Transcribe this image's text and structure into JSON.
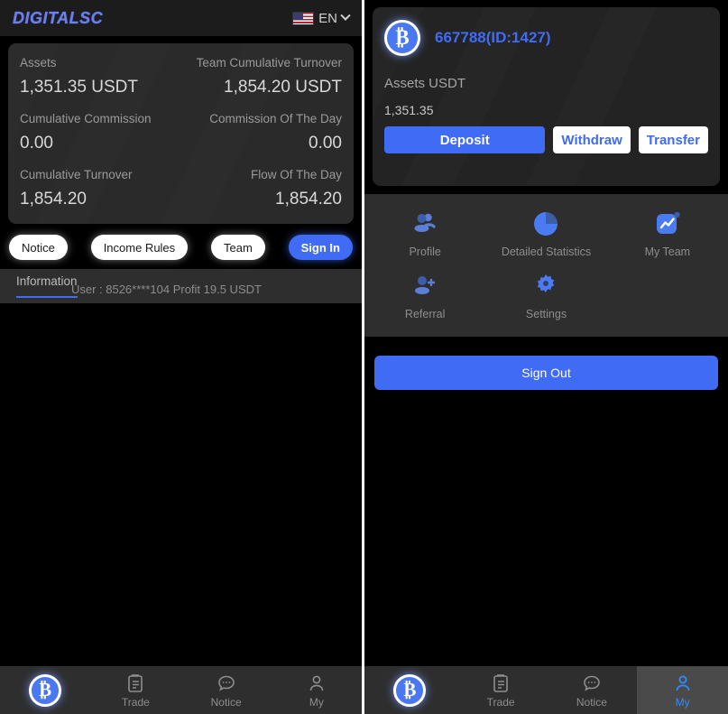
{
  "left": {
    "header": {
      "brand": "DIGITALSC",
      "lang": "EN",
      "flag_icon": "us-flag-icon",
      "chevron_icon": "chevron-down-icon"
    },
    "stats": [
      {
        "label": "Assets",
        "value": "1,351.35 USDT"
      },
      {
        "label": "Team Cumulative Turnover",
        "value": "1,854.20 USDT"
      },
      {
        "label": "Cumulative Commission",
        "value": "0.00"
      },
      {
        "label": "Commission Of The Day",
        "value": "0.00"
      },
      {
        "label": "Cumulative Turnover",
        "value": "1,854.20"
      },
      {
        "label": "Flow Of The Day",
        "value": "1,854.20"
      }
    ],
    "pills": [
      {
        "label": "Notice",
        "style": "white"
      },
      {
        "label": "Income Rules",
        "style": "white"
      },
      {
        "label": "Team",
        "style": "white"
      },
      {
        "label": "Sign In",
        "style": "primary"
      }
    ],
    "info": {
      "tab": "Information",
      "ticker": "User : 8526****104 Profit 19.5 USDT"
    },
    "nav": [
      {
        "label": "",
        "icon": "bitcoin-icon",
        "active": false
      },
      {
        "label": "Trade",
        "icon": "clipboard-icon",
        "active": false
      },
      {
        "label": "Notice",
        "icon": "chat-bubble-icon",
        "active": false
      },
      {
        "label": "My",
        "icon": "person-icon",
        "active": false
      }
    ]
  },
  "right": {
    "profile": {
      "avatar_icon": "bitcoin-icon",
      "name": "667788(ID:1427)",
      "assets_label": "Assets USDT",
      "assets_value": "1,351.35",
      "actions": [
        {
          "label": "Deposit",
          "style": "fill"
        },
        {
          "label": "Withdraw",
          "style": "outline"
        },
        {
          "label": "Transfer",
          "style": "outline"
        }
      ]
    },
    "menu": [
      {
        "label": "Profile",
        "icon": "people-icon"
      },
      {
        "label": "Detailed Statistics",
        "icon": "pie-chart-icon"
      },
      {
        "label": "My Team",
        "icon": "chart-trend-icon"
      },
      {
        "label": "Referral",
        "icon": "person-add-icon"
      },
      {
        "label": "Settings",
        "icon": "gear-icon"
      }
    ],
    "signout": "Sign Out",
    "nav": [
      {
        "label": "",
        "icon": "bitcoin-icon",
        "active": false
      },
      {
        "label": "Trade",
        "icon": "clipboard-icon",
        "active": false
      },
      {
        "label": "Notice",
        "icon": "chat-bubble-icon",
        "active": false
      },
      {
        "label": "My",
        "icon": "person-icon",
        "active": true
      }
    ]
  },
  "colors": {
    "accent": "#3f6bf5",
    "card": "#2a2a2a",
    "bar": "#2e2e2e",
    "active_nav": "#2f8cff"
  }
}
